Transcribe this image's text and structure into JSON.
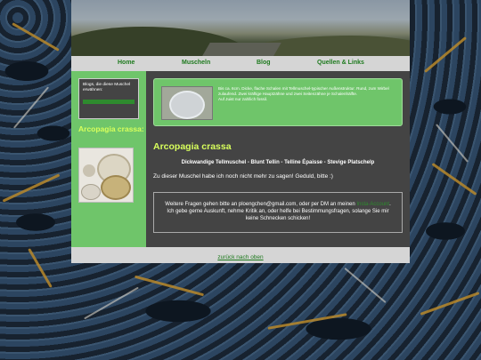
{
  "nav": {
    "items": [
      {
        "label": "Home"
      },
      {
        "label": "Muscheln"
      },
      {
        "label": "Blog"
      },
      {
        "label": "Quellen & Links"
      }
    ]
  },
  "sidebar": {
    "box_text": "Blogs, die diese Muschel erwähnen:",
    "species_title": "Arcopagia crassa:"
  },
  "main": {
    "intro_text": "Bis ca. 6cm. Dicke, flache Schalen mit Tellmuschel-typischer Außenstruktur. Rund, zum Wirbel zulaufend. Zwei kräftige Hauptzähne und zwei Seitenzähne je Schalenhälfte.",
    "intro_text2": "Auf Juist nur zahllich fossil.",
    "title": "Arcopagia crassa",
    "subtitle": "Dickwandige Tellmuschel - Blunt Tellin - Telline Épaisse - Stevige Platschelp",
    "note": "Zu dieser Muschel habe ich noch nicht mehr zu sagen! Geduld, bitte :)",
    "contact_pre": "Weitere Fragen gehen bitte an ploengchen@gmail.com, oder per DM an meinen ",
    "contact_link": "Insta-Account",
    "contact_post": ". Ich gebe gerne Auskunft, nehme Kritik an, oder helfe bei Bestimmungsfragen, solange Sie mir keine Schnecken schicken!"
  },
  "footer": {
    "back_to_top": "zurück nach oben"
  },
  "colors": {
    "accent_green": "#6fc56a",
    "title_yellow": "#d8ff5c",
    "link_green": "#1e7a1e",
    "panel_dark": "#444444"
  }
}
